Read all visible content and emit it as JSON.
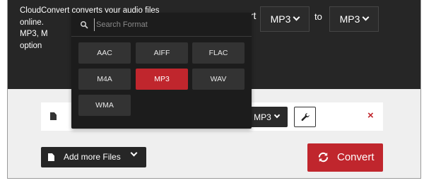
{
  "colors": {
    "accent": "#c0262d",
    "dark": "#262626",
    "panel": "#1c1c1c",
    "option": "#333333"
  },
  "hero": {
    "description_lines": [
      "CloudConvert converts your audio files",
      "online.",
      "MP3, M",
      "option"
    ],
    "convert_word_fragment": "ert",
    "from_format": "MP3",
    "to_label": "to",
    "to_format": "MP3"
  },
  "dropdown": {
    "search_placeholder": "Search Format",
    "options": [
      {
        "label": "AAC",
        "selected": false
      },
      {
        "label": "AIFF",
        "selected": false
      },
      {
        "label": "FLAC",
        "selected": false
      },
      {
        "label": "M4A",
        "selected": false
      },
      {
        "label": "MP3",
        "selected": true
      },
      {
        "label": "WAV",
        "selected": false
      },
      {
        "label": "WMA",
        "selected": false
      }
    ],
    "icons": {
      "search": "search-icon"
    }
  },
  "file_row": {
    "format": "MP3",
    "icons": {
      "file": "file-icon",
      "settings": "wrench-icon",
      "remove": "close-icon"
    },
    "remove_symbol": "×"
  },
  "actions": {
    "add_files_label": "Add more Files",
    "convert_label": "Convert",
    "icons": {
      "add": "add-file-icon",
      "convert": "refresh-icon"
    }
  }
}
